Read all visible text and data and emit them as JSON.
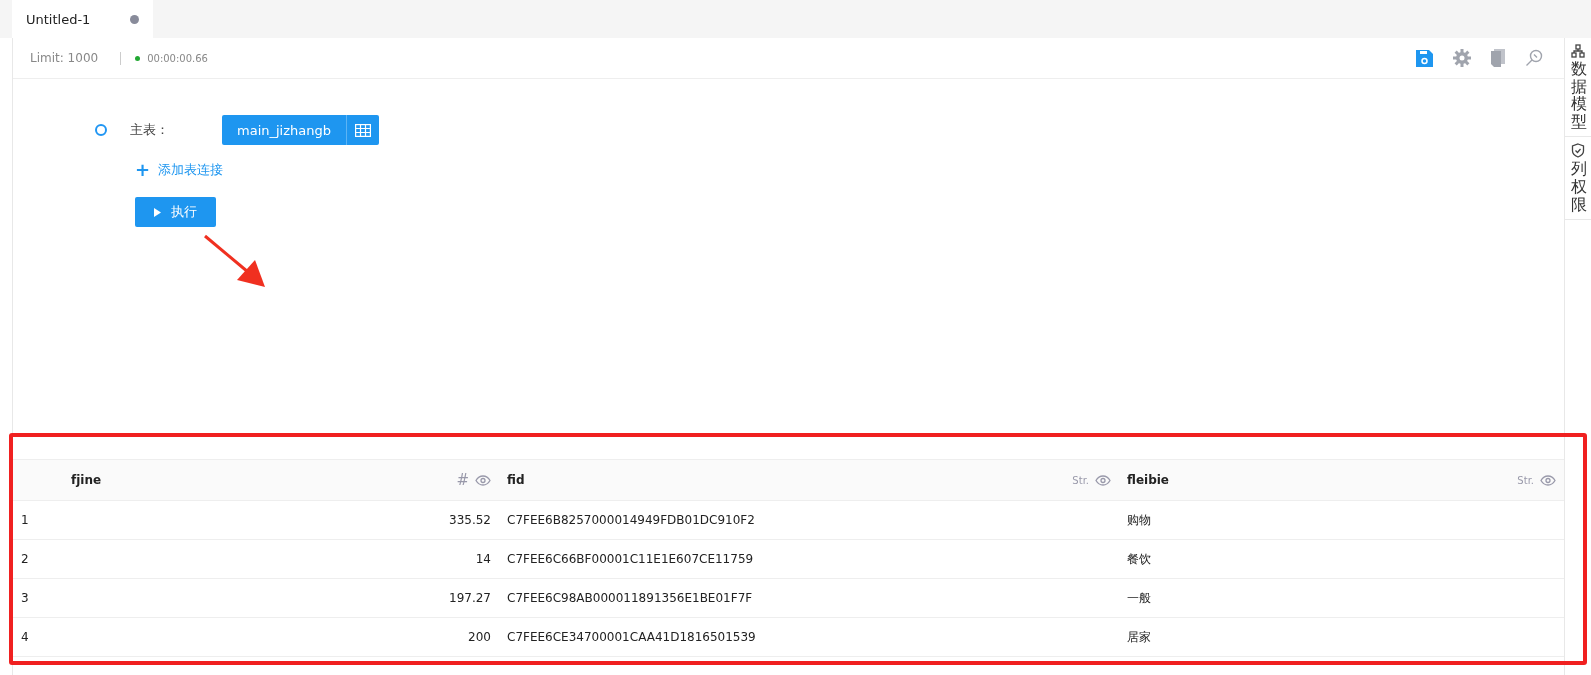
{
  "tabs": [
    {
      "label": "Untitled-1",
      "selected": true,
      "modified": true
    }
  ],
  "toolbar": {
    "limit": "Limit: 1000",
    "elapsed": "00:00:00.66"
  },
  "query": {
    "main_table_label": "主表：",
    "main_table": "main_jizhangb",
    "add_join": "添加表连接",
    "add_join_icon": "+",
    "run_button": "执行"
  },
  "side_panel": [
    {
      "label": "数据模型",
      "kind": "model"
    },
    {
      "label": "列权限",
      "kind": "permission"
    }
  ],
  "table": {
    "columns": [
      {
        "name": "fjine",
        "type_label": "#",
        "kind": "number"
      },
      {
        "name": "fid",
        "type_label": "Str.",
        "kind": "string"
      },
      {
        "name": "fleibie",
        "type_label": "Str.",
        "kind": "string"
      }
    ],
    "rows": [
      {
        "index": "1",
        "cells": [
          "335.52",
          "C7FEE6B8257000014949FDB01DC910F2",
          "购物"
        ]
      },
      {
        "index": "2",
        "cells": [
          "14",
          "C7FEE6C66BF00001C11E1E607CE11759",
          "餐饮"
        ]
      },
      {
        "index": "3",
        "cells": [
          "197.27",
          "C7FEE6C98AB000011891356E1BE01F7F",
          "一般"
        ]
      },
      {
        "index": "4",
        "cells": [
          "200",
          "C7FEE6CE34700001CAA41D1816501539",
          "居家"
        ]
      }
    ]
  }
}
